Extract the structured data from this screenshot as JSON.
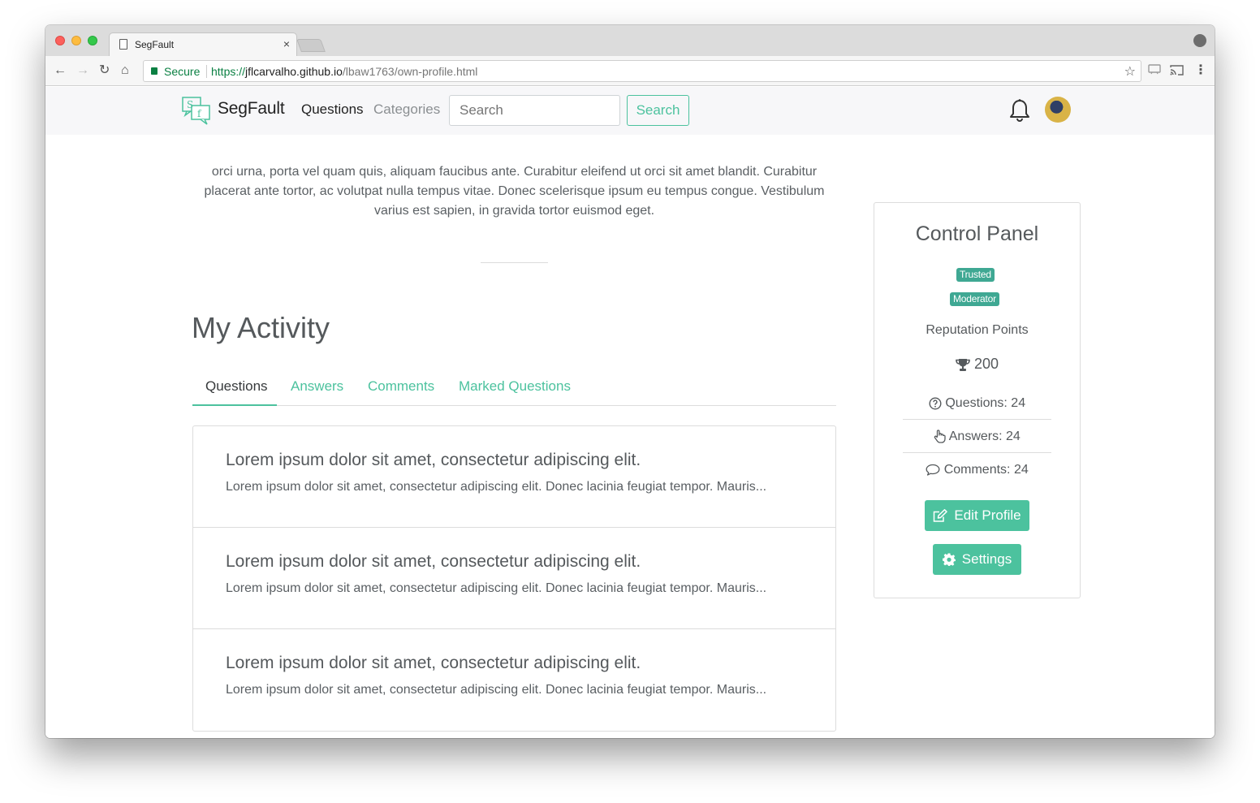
{
  "browser": {
    "tab_title": "SegFault",
    "tab_close": "×",
    "secure_label": "Secure",
    "url_scheme": "https://",
    "url_host": "jflcarvalho.github.io",
    "url_path": "/lbaw1763/own-profile.html",
    "back": "←",
    "forward": "→",
    "reload": "↻",
    "home": "⌂",
    "bookmark": "☆",
    "menu": "⋮"
  },
  "navbar": {
    "brand": "SegFault",
    "links": {
      "questions": "Questions",
      "categories": "Categories"
    },
    "search_placeholder": "Search",
    "search_button": "Search",
    "accent_color": "#4cc29e"
  },
  "intro": {
    "text": "orci urna, porta vel quam quis, aliquam faucibus ante. Curabitur eleifend ut orci sit amet blandit. Curabitur placerat ante tortor, ac volutpat nulla tempus vitae. Donec scelerisque ipsum eu tempus congue. Vestibulum varius est sapien, in gravida tortor euismod eget."
  },
  "activity": {
    "title": "My Activity",
    "tabs": [
      "Questions",
      "Answers",
      "Comments",
      "Marked Questions"
    ],
    "active_tab": "Questions",
    "items": [
      {
        "title": "Lorem ipsum dolor sit amet, consectetur adipiscing elit.",
        "excerpt": "Lorem ipsum dolor sit amet, consectetur adipiscing elit. Donec lacinia feugiat tempor. Mauris..."
      },
      {
        "title": "Lorem ipsum dolor sit amet, consectetur adipiscing elit.",
        "excerpt": "Lorem ipsum dolor sit amet, consectetur adipiscing elit. Donec lacinia feugiat tempor. Mauris..."
      },
      {
        "title": "Lorem ipsum dolor sit amet, consectetur adipiscing elit.",
        "excerpt": "Lorem ipsum dolor sit amet, consectetur adipiscing elit. Donec lacinia feugiat tempor. Mauris..."
      }
    ]
  },
  "control_panel": {
    "title": "Control Panel",
    "badges": [
      "Trusted",
      "Moderator"
    ],
    "badge_color": "#3fa893",
    "reputation_label": "Reputation Points",
    "reputation_points": "200",
    "stats": {
      "questions_label": "Questions",
      "questions_value": "24",
      "answers_label": "Answers",
      "answers_value": "24",
      "comments_label": "Comments",
      "comments_value": "24",
      "separator": ":"
    },
    "edit_profile": "Edit Profile",
    "settings": "Settings"
  }
}
